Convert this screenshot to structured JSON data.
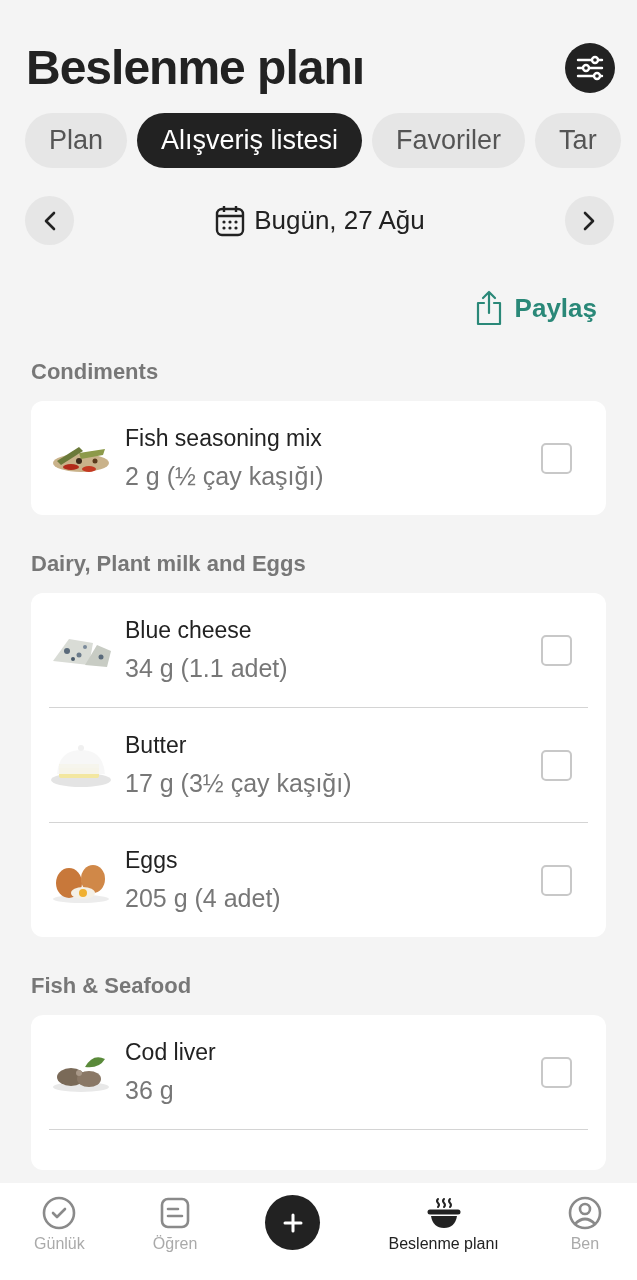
{
  "header": {
    "title": "Beslenme planı"
  },
  "tabs": [
    {
      "label": "Plan",
      "selected": false
    },
    {
      "label": "Alışveriş listesi",
      "selected": true
    },
    {
      "label": "Favoriler",
      "selected": false
    },
    {
      "label": "Tar",
      "selected": false
    }
  ],
  "date_nav": {
    "label": "Bugün, 27 Ağu"
  },
  "share": {
    "label": "Paylaş"
  },
  "sections": [
    {
      "title": "Condiments",
      "items": [
        {
          "name": "Fish seasoning mix",
          "amount": "2 g (½ çay kaşığı)",
          "checked": false
        }
      ]
    },
    {
      "title": "Dairy, Plant milk and Eggs",
      "items": [
        {
          "name": "Blue cheese",
          "amount": "34 g (1.1 adet)",
          "checked": false
        },
        {
          "name": "Butter",
          "amount": "17 g (3½ çay kaşığı)",
          "checked": false
        },
        {
          "name": "Eggs",
          "amount": "205 g (4 adet)",
          "checked": false
        }
      ]
    },
    {
      "title": "Fish & Seafood",
      "items": [
        {
          "name": "Cod liver",
          "amount": "36 g",
          "checked": false
        }
      ]
    }
  ],
  "bottom_nav": [
    {
      "kind": "check",
      "label": "Günlük",
      "selected": false
    },
    {
      "kind": "note",
      "label": "Öğren",
      "selected": false
    },
    {
      "kind": "add",
      "selected": false
    },
    {
      "kind": "bowl",
      "label": "Beslenme planı",
      "selected": true
    },
    {
      "kind": "person",
      "label": "Ben",
      "selected": false
    }
  ]
}
